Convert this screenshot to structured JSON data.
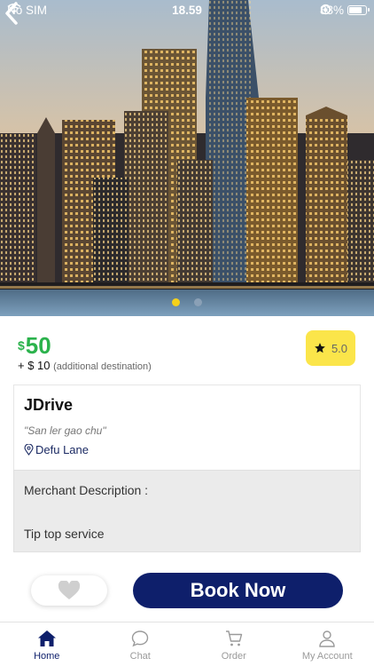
{
  "status_bar": {
    "carrier": "No SIM",
    "time": "18.59",
    "battery_percent": "83%",
    "battery_level": 0.83
  },
  "gallery": {
    "slide_count": 2,
    "active_index": 0
  },
  "pricing": {
    "currency_symbol": "$",
    "price": "50",
    "extra_prefix": "+ $ 10",
    "extra_note": "(additional destination)"
  },
  "rating": {
    "value": "5.0"
  },
  "merchant": {
    "name": "JDrive",
    "tagline": "\"San ler gao chu\"",
    "location": "Defu Lane",
    "description_title": "Merchant Description :",
    "description_body": "Tip top service"
  },
  "actions": {
    "book_label": "Book Now"
  },
  "tabbar": {
    "items": [
      {
        "label": "Home",
        "icon": "home-icon",
        "active": true
      },
      {
        "label": "Chat",
        "icon": "chat-icon",
        "active": false
      },
      {
        "label": "Order",
        "icon": "cart-icon",
        "active": false
      },
      {
        "label": "My Account",
        "icon": "user-icon",
        "active": false
      }
    ]
  },
  "colors": {
    "accent": "#0e1f6b",
    "price_green": "#2bb24c",
    "rating_yellow": "#fbe54a",
    "active_dot": "#f5d11a"
  }
}
